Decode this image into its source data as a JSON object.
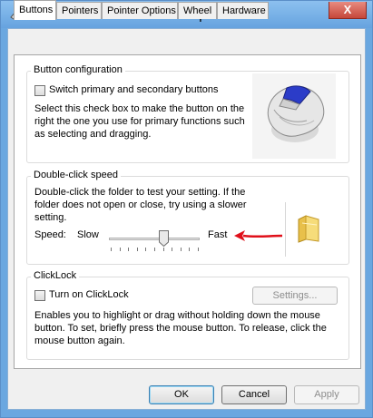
{
  "window": {
    "title": "Mouse Properties",
    "close_label": "X"
  },
  "tabs": [
    "Buttons",
    "Pointers",
    "Pointer Options",
    "Wheel",
    "Hardware"
  ],
  "button_configuration": {
    "legend": "Button configuration",
    "checkbox_label": "Switch primary and secondary buttons",
    "checkbox_checked": false,
    "desc_lines": [
      "Select this check box to make the button on the",
      "right the one you use for primary functions such",
      "as selecting and dragging."
    ]
  },
  "double_click": {
    "legend": "Double-click speed",
    "desc_lines": [
      "Double-click the folder to test your setting. If the",
      "folder does not open or close, try using a slower",
      "setting."
    ],
    "speed_label": "Speed:",
    "slow_label": "Slow",
    "fast_label": "Fast",
    "slider_value_fraction": 0.6
  },
  "clicklock": {
    "legend": "ClickLock",
    "checkbox_label": "Turn on ClickLock",
    "checkbox_checked": false,
    "settings_label": "Settings...",
    "desc_lines": [
      "Enables you to highlight or drag without holding down the mouse",
      "button. To set, briefly press the mouse button. To release, click the",
      "mouse button again."
    ]
  },
  "footer": {
    "ok": "OK",
    "cancel": "Cancel",
    "apply": "Apply"
  },
  "colors": {
    "accent_arrow": "#e0101a",
    "title_bar": "#7ab4e8"
  }
}
